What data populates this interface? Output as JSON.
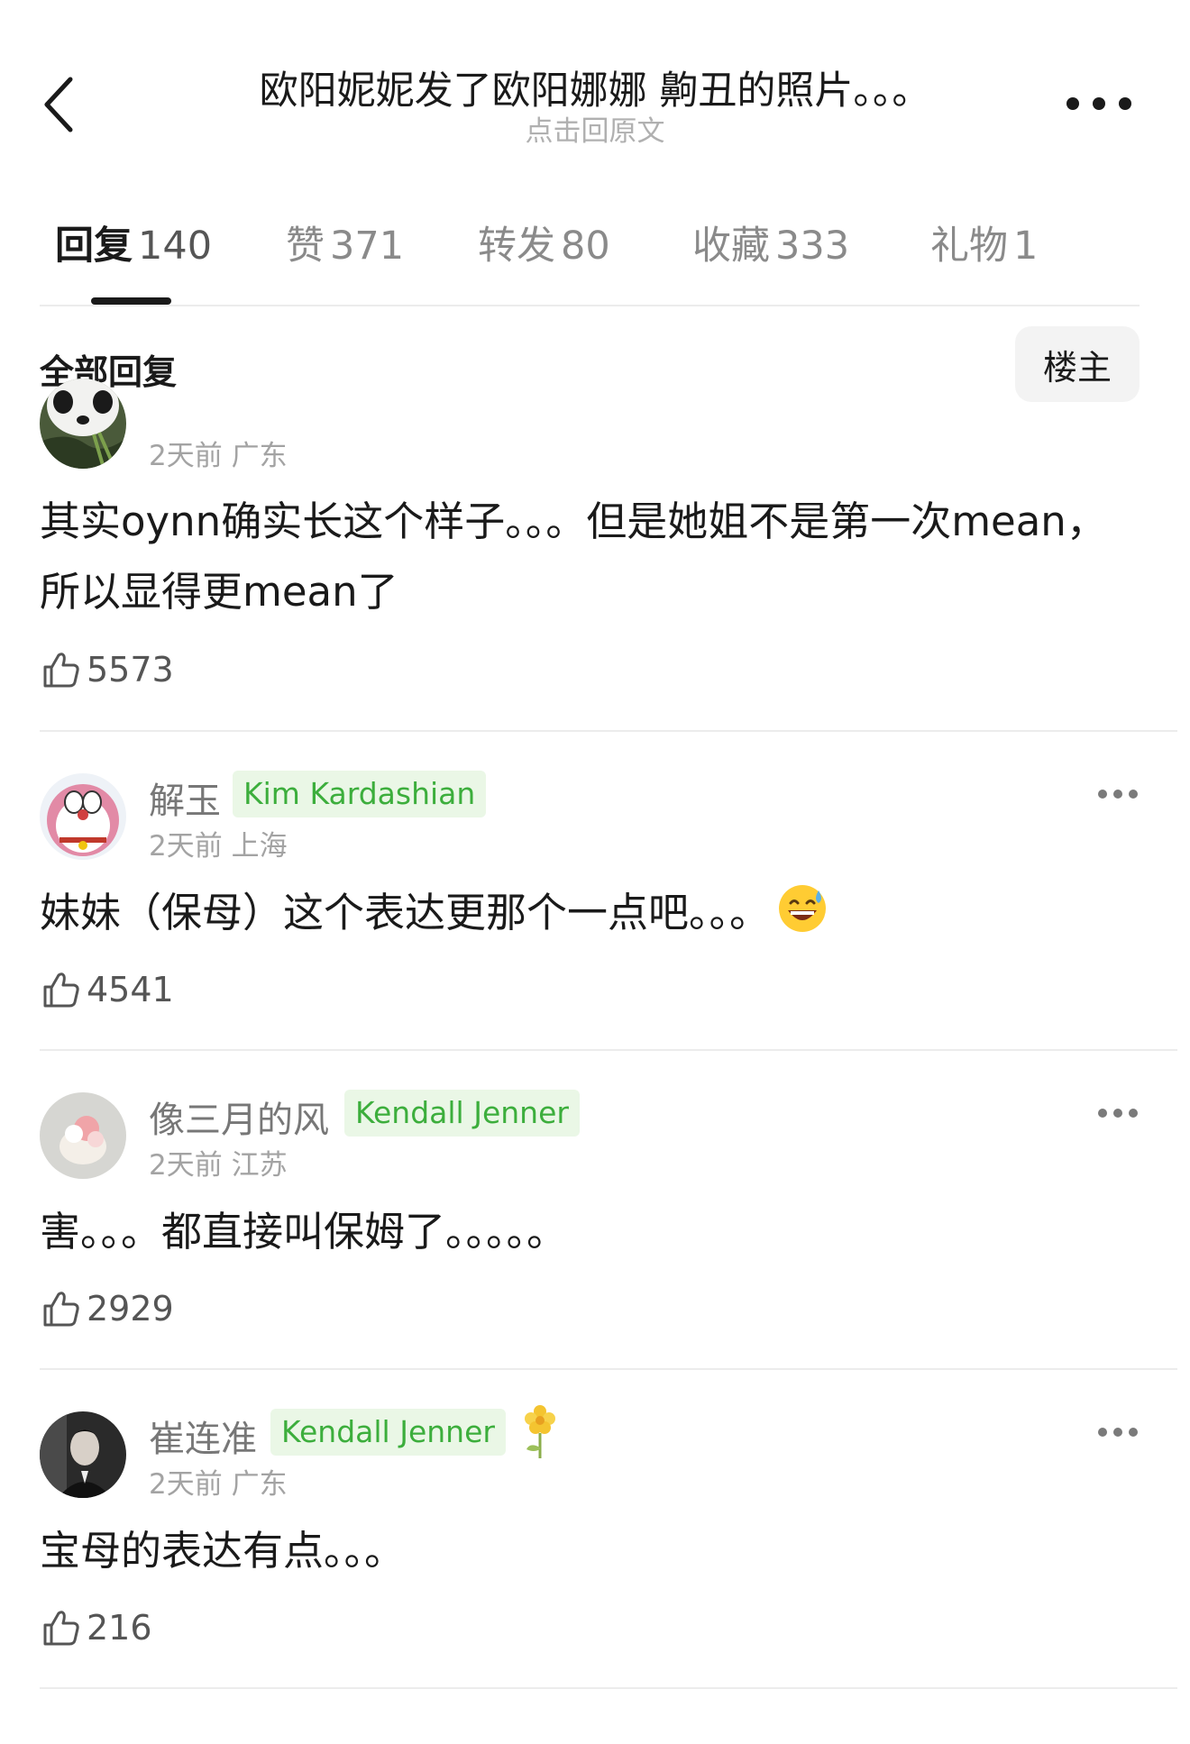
{
  "header": {
    "title": "欧阳妮妮发了欧阳娜娜 齁丑的照片。。。",
    "subtitle": "点击回原文"
  },
  "tabs": [
    {
      "label": "回复",
      "count": "140"
    },
    {
      "label": "赞",
      "count": "371"
    },
    {
      "label": "转发",
      "count": "80"
    },
    {
      "label": "收藏",
      "count": "333"
    },
    {
      "label": "礼物",
      "count": "1"
    }
  ],
  "filter": {
    "label": "全部回复",
    "op_button": "楼主"
  },
  "comments": [
    {
      "name": "",
      "tag": "",
      "meta": "2天前 广东",
      "text": "其实oynn确实长这个样子。。。但是她姐不是第一次mean，所以显得更mean了",
      "likes": "5573",
      "avatar": "panda-avatar"
    },
    {
      "name": "解玉",
      "tag": "Kim Kardashian",
      "meta": "2天前 上海",
      "text": "妹妹（保母）这个表达更那个一点吧。。。",
      "emoji": "sweat-smile-emoji",
      "likes": "4541",
      "avatar": "doraemon-avatar"
    },
    {
      "name": "像三月的风",
      "tag": "Kendall Jenner",
      "meta": "2天前 江苏",
      "text": "害。。。都直接叫保姆了。。。。。",
      "likes": "2929",
      "avatar": "plush-toy-avatar"
    },
    {
      "name": "崔连准",
      "tag": "Kendall Jenner",
      "badge": "flower-badge-icon",
      "meta": "2天前 广东",
      "text": "宝母的表达有点。。。",
      "likes": "216",
      "avatar": "man-portrait-avatar"
    }
  ],
  "colors": {
    "tag_bg": "#eaf7e6",
    "tag_text": "#3cae3c",
    "divider": "#ececec"
  }
}
